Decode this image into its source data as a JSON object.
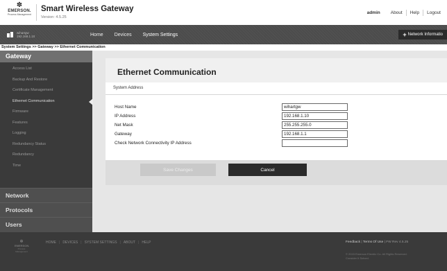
{
  "header": {
    "logo_brand": "EMERSON.",
    "logo_sub": "Process Management",
    "title": "Smart Wireless Gateway",
    "version": "Version: 4.5.25",
    "user": "admin",
    "links": [
      "About",
      "Help",
      "Logout"
    ]
  },
  "navbar": {
    "device_name": "wihartgw",
    "device_ip": "192.168.1.10",
    "items": [
      "Home",
      "Devices",
      "System Settings"
    ],
    "network_info": "Network Informatio"
  },
  "breadcrumb": "System Settings >> Gateway >> Ethernet Communication",
  "sidebar": {
    "header": "Gateway",
    "items": [
      "Access List",
      "Backup And Restore",
      "Certificate Management",
      "Ethernet Communication",
      "Firmware",
      "Features",
      "Logging",
      "Redundancy Status",
      "Redundancy",
      "Time"
    ],
    "active_index": 3,
    "sections": [
      "Network",
      "Protocols",
      "Users"
    ]
  },
  "panel": {
    "title": "Ethernet Communication",
    "section": "System Address",
    "fields": [
      {
        "label": "Host Name",
        "value": "wihartgw"
      },
      {
        "label": "IP Address",
        "value": "192.168.1.10"
      },
      {
        "label": "Net Mask",
        "value": "255.255.255.0"
      },
      {
        "label": "Gateway",
        "value": "192.168.1.1"
      },
      {
        "label": "Check Network Connectivity IP Address",
        "value": ""
      }
    ],
    "save_label": "Save Changes",
    "cancel_label": "Cancel"
  },
  "footer": {
    "nav": [
      "HOME",
      "DEVICES",
      "SYSTEM SETTINGS",
      "ABOUT",
      "HELP"
    ],
    "feedback": "Feedback",
    "terms": "Terms Of Use",
    "fw": "FW Rev 4.5.25",
    "copyright_1": "© 2015 Emerson Electric Co. All Rights Reserved.",
    "copyright_2": "Consider It Solved."
  },
  "colors": {
    "navbar": "#4c4c4c",
    "sidebar": "#3a3a3a",
    "cancel_button": "#2b2b2b",
    "save_button_disabled": "#c9c9c9"
  }
}
